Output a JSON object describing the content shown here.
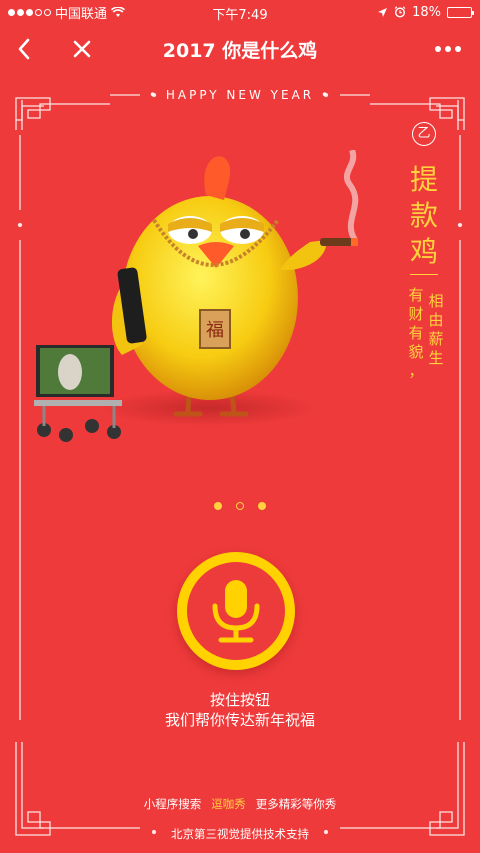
{
  "status_bar": {
    "carrier": "中国联通",
    "time": "下午7:49",
    "battery_percent": "18%",
    "battery_level": 0.18
  },
  "nav": {
    "title": "2017 你是什么鸡",
    "back_icon": "chevron-left-icon",
    "close_icon": "close-icon",
    "more_icon": "more-dots-icon"
  },
  "banner": {
    "happy_new_year": "HAPPY NEW YEAR"
  },
  "character": {
    "name_vertical": [
      "提",
      "款",
      "鸡"
    ],
    "badge_glyph": "乙",
    "tagline_col1": [
      "有",
      "财",
      "有",
      "貌",
      "，"
    ],
    "tagline_col2": [
      "相",
      "由",
      "薪",
      "生"
    ],
    "pendant_glyph": "福"
  },
  "carousel": {
    "active_index": 1,
    "count": 3
  },
  "record": {
    "hint_line1": "按住按钮",
    "hint_line2": "我们帮你传达新年祝福"
  },
  "footer": {
    "prefix": "小程序搜索",
    "highlight": "逗咖秀",
    "suffix": "更多精彩等你秀",
    "credit": "北京第三视觉提供技术支持"
  },
  "colors": {
    "background": "#ee3a3b",
    "accent_gold": "#ffd23e",
    "mic_ring": "#ffd200"
  }
}
